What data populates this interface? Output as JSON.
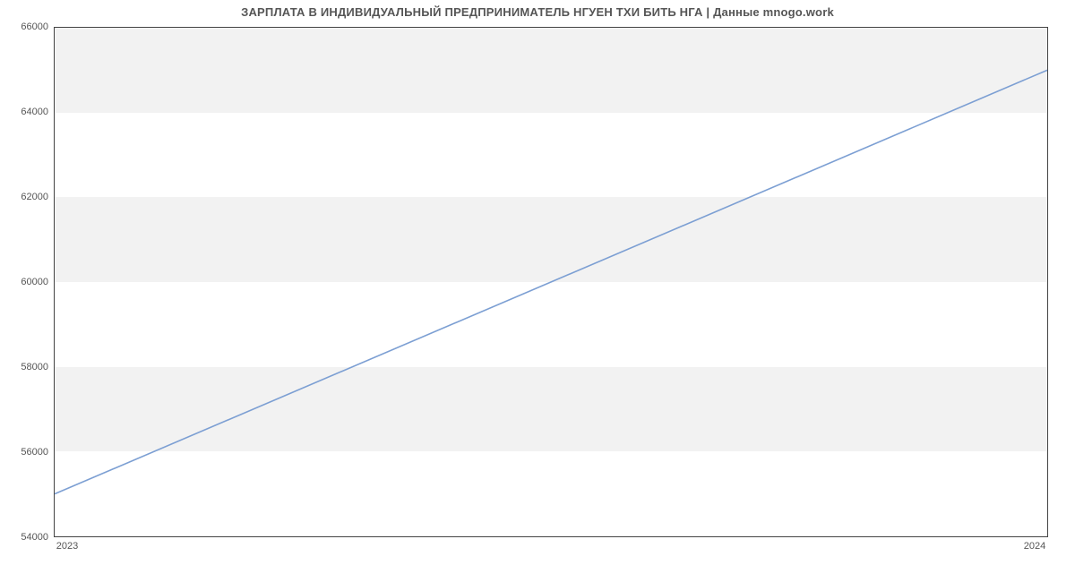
{
  "chart_data": {
    "type": "line",
    "title": "ЗАРПЛАТА В ИНДИВИДУАЛЬНЫЙ ПРЕДПРИНИМАТЕЛЬ НГУЕН ТХИ БИТЬ НГА | Данные mnogo.work",
    "x": [
      2023,
      2024
    ],
    "values": [
      55000,
      65000
    ],
    "xlabel": "",
    "ylabel": "",
    "xlim": [
      2023,
      2024
    ],
    "ylim": [
      54000,
      66000
    ],
    "x_ticks": [
      2023,
      2024
    ],
    "y_ticks": [
      54000,
      56000,
      58000,
      60000,
      62000,
      64000,
      66000
    ],
    "series_color": "#7c9fd3",
    "band_color": "#f2f2f2",
    "grid": false
  }
}
